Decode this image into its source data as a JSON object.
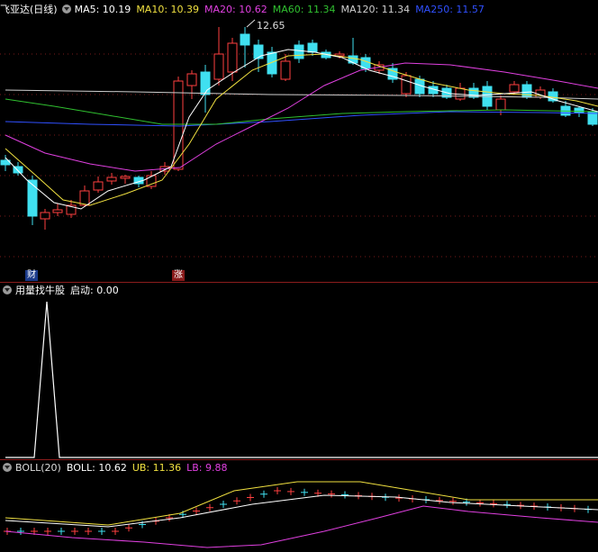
{
  "main": {
    "stock": "飞亚达(日线)",
    "ma": [
      {
        "label": "MA5: 10.19",
        "color": "#ffffff"
      },
      {
        "label": "MA10: 10.39",
        "color": "#f0e040"
      },
      {
        "label": "MA20: 10.62",
        "color": "#e040e0"
      },
      {
        "label": "MA60: 11.34",
        "color": "#30c030"
      },
      {
        "label": "MA120: 11.34",
        "color": "#cfcfcf"
      },
      {
        "label": "MA250: 11.57",
        "color": "#3050ff"
      }
    ],
    "high_label": "12.65",
    "tag_cai": "财",
    "tag_zhang": "涨"
  },
  "indicator": {
    "name": "用量找牛股",
    "value": "启动: 0.00"
  },
  "boll": {
    "name": "BOLL(20)",
    "boll": "BOLL: 10.62",
    "ub": "UB: 11.36",
    "lb": "LB: 9.88",
    "colors": {
      "name": "#dddddd",
      "boll": "#ffffff",
      "ub": "#f0e040",
      "lb": "#e040e0"
    }
  },
  "colors": {
    "up": "#ff4040",
    "down": "#40e0f0",
    "grid": "#7a1a1a"
  }
}
